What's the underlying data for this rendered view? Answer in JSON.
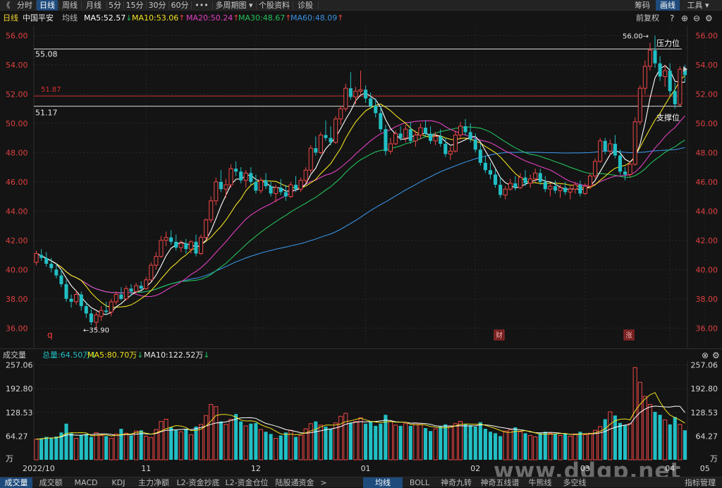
{
  "top_bar": {
    "back_glyph": "《",
    "tabs": [
      "分时",
      "日线",
      "周线",
      "月线",
      "5分",
      "15分",
      "30分",
      "60分",
      "•••",
      "多周期图 ▾",
      "个股资料",
      "诊股"
    ],
    "active_tab": 1,
    "right_items": [
      "筹码",
      "画线",
      "工具 ▾"
    ],
    "active_right": 1
  },
  "ma_bar": {
    "period": "日线",
    "stock_name": "中国平安",
    "label": "均线",
    "ma5": "MA5:52.57",
    "ma10": "MA10:53.06",
    "ma20": "MA20:50.24",
    "ma30": "MA30:48.67",
    "ma60": "MA60:48.09",
    "restore": "前复权"
  },
  "colors": {
    "up": "#f04646",
    "down": "#21bfc4",
    "ma5": "#ffffff",
    "ma10": "#f0e020",
    "ma20": "#e040c0",
    "ma30": "#22c05a",
    "ma60": "#3890e0"
  },
  "price_chart": {
    "y_ticks": [
      "56.00",
      "54.00",
      "52.00",
      "50.00",
      "48.00",
      "46.00",
      "44.00",
      "42.00",
      "40.00",
      "38.00",
      "36.00"
    ],
    "ylim": [
      35,
      56.6
    ],
    "lines": [
      {
        "label": "55.08",
        "value": 55.08,
        "color": "#d8d8d8"
      },
      {
        "label": "51.87",
        "value": 51.87,
        "color": "#d83030"
      },
      {
        "label": "51.17",
        "value": 51.17,
        "color": "#d8d8d8"
      }
    ],
    "annotations": {
      "high": "56.00→",
      "low": "←35.90",
      "pressure": "压力位",
      "support": "支撑位"
    },
    "markers": {
      "q": "q",
      "cai": "财",
      "zhang": "涨"
    }
  },
  "chart_data": {
    "type": "candlestick",
    "period": "日线",
    "x_axis_labels": [
      "2022/10",
      "11",
      "12",
      "01",
      "02",
      "03",
      "04",
      "05"
    ],
    "candles_ohlc": [
      [
        40.5,
        41.3,
        40.3,
        41.1
      ],
      [
        41.0,
        41.4,
        40.6,
        40.8
      ],
      [
        40.8,
        41.2,
        40.2,
        40.4
      ],
      [
        40.4,
        40.8,
        39.8,
        40.1
      ],
      [
        40.0,
        40.4,
        39.4,
        39.6
      ],
      [
        39.6,
        40.0,
        38.8,
        39.0
      ],
      [
        39.0,
        39.3,
        37.8,
        38.0
      ],
      [
        38.0,
        38.3,
        37.4,
        37.8
      ],
      [
        37.8,
        38.6,
        37.6,
        38.3
      ],
      [
        38.3,
        38.5,
        37.2,
        37.5
      ],
      [
        37.5,
        37.8,
        36.7,
        37.0
      ],
      [
        37.0,
        37.3,
        36.2,
        36.4
      ],
      [
        36.4,
        37.1,
        35.9,
        36.9
      ],
      [
        36.8,
        37.5,
        36.5,
        37.2
      ],
      [
        37.2,
        37.8,
        36.9,
        37.1
      ],
      [
        37.1,
        38.0,
        36.8,
        37.8
      ],
      [
        37.8,
        38.5,
        37.6,
        38.3
      ],
      [
        38.3,
        38.8,
        37.9,
        38.0
      ],
      [
        38.0,
        38.9,
        37.9,
        38.7
      ],
      [
        38.7,
        39.0,
        38.2,
        38.5
      ],
      [
        38.5,
        39.1,
        38.4,
        38.9
      ],
      [
        38.9,
        39.2,
        38.6,
        38.7
      ],
      [
        38.7,
        39.5,
        38.6,
        39.3
      ],
      [
        39.3,
        40.5,
        39.2,
        40.3
      ],
      [
        40.3,
        41.2,
        40.0,
        40.9
      ],
      [
        40.9,
        42.3,
        40.8,
        42.0
      ],
      [
        42.0,
        42.6,
        41.6,
        42.2
      ],
      [
        42.2,
        42.7,
        41.7,
        41.9
      ],
      [
        41.9,
        42.4,
        41.3,
        41.5
      ],
      [
        41.5,
        42.0,
        41.2,
        41.8
      ],
      [
        41.8,
        42.1,
        41.1,
        41.4
      ],
      [
        41.4,
        42.0,
        41.1,
        41.9
      ],
      [
        41.9,
        42.4,
        40.9,
        41.1
      ],
      [
        41.1,
        42.4,
        41.0,
        42.2
      ],
      [
        42.2,
        43.5,
        42.0,
        43.4
      ],
      [
        43.4,
        45.0,
        43.2,
        44.7
      ],
      [
        44.7,
        46.3,
        44.4,
        46.0
      ],
      [
        46.0,
        46.8,
        45.3,
        45.5
      ],
      [
        45.5,
        46.2,
        44.9,
        45.8
      ],
      [
        45.8,
        47.2,
        45.6,
        46.9
      ],
      [
        46.9,
        47.4,
        46.4,
        46.7
      ],
      [
        46.7,
        47.0,
        45.9,
        46.1
      ],
      [
        46.1,
        46.8,
        45.6,
        46.6
      ],
      [
        46.6,
        47.0,
        45.8,
        46.0
      ],
      [
        46.0,
        46.5,
        45.2,
        45.4
      ],
      [
        45.4,
        46.3,
        45.2,
        46.1
      ],
      [
        46.1,
        46.6,
        45.5,
        45.7
      ],
      [
        45.7,
        46.0,
        45.0,
        45.2
      ],
      [
        45.2,
        45.8,
        44.6,
        45.6
      ],
      [
        45.6,
        46.2,
        45.1,
        45.3
      ],
      [
        45.3,
        45.8,
        44.7,
        45.0
      ],
      [
        45.0,
        46.0,
        44.9,
        45.8
      ],
      [
        45.8,
        46.4,
        45.3,
        45.5
      ],
      [
        45.5,
        46.3,
        45.3,
        46.1
      ],
      [
        46.1,
        47.0,
        45.9,
        46.8
      ],
      [
        46.8,
        48.5,
        46.6,
        48.3
      ],
      [
        48.3,
        49.1,
        47.8,
        48.0
      ],
      [
        48.0,
        49.4,
        47.9,
        49.2
      ],
      [
        49.2,
        50.2,
        48.8,
        49.0
      ],
      [
        49.0,
        49.8,
        48.5,
        48.7
      ],
      [
        48.7,
        50.5,
        48.6,
        50.3
      ],
      [
        50.3,
        51.2,
        49.9,
        51.0
      ],
      [
        51.0,
        52.7,
        50.8,
        52.4
      ],
      [
        52.4,
        53.5,
        51.6,
        51.8
      ],
      [
        51.8,
        52.5,
        51.3,
        52.2
      ],
      [
        52.2,
        53.6,
        52.0,
        52.3
      ],
      [
        52.3,
        52.6,
        51.4,
        51.7
      ],
      [
        51.7,
        52.1,
        51.0,
        51.2
      ],
      [
        51.2,
        51.7,
        50.4,
        50.7
      ],
      [
        50.7,
        51.2,
        49.4,
        49.6
      ],
      [
        49.6,
        49.9,
        47.8,
        48.1
      ],
      [
        48.1,
        49.0,
        47.9,
        48.6
      ],
      [
        48.6,
        49.5,
        48.5,
        49.3
      ],
      [
        49.3,
        49.8,
        48.8,
        49.0
      ],
      [
        49.0,
        49.9,
        48.7,
        49.6
      ],
      [
        49.6,
        50.1,
        48.6,
        48.8
      ],
      [
        48.8,
        49.5,
        48.4,
        49.2
      ],
      [
        49.2,
        50.0,
        48.9,
        49.7
      ],
      [
        49.7,
        50.2,
        49.1,
        49.3
      ],
      [
        49.3,
        49.8,
        48.6,
        48.8
      ],
      [
        48.8,
        49.4,
        48.5,
        49.1
      ],
      [
        49.1,
        49.6,
        48.4,
        48.6
      ],
      [
        48.6,
        49.0,
        47.7,
        47.9
      ],
      [
        47.9,
        48.4,
        47.5,
        48.1
      ],
      [
        48.1,
        49.5,
        48.0,
        49.2
      ],
      [
        49.2,
        50.1,
        48.9,
        49.8
      ],
      [
        49.8,
        50.3,
        49.2,
        49.4
      ],
      [
        49.4,
        50.0,
        48.7,
        48.9
      ],
      [
        48.9,
        49.3,
        48.0,
        48.2
      ],
      [
        48.2,
        48.6,
        47.1,
        47.3
      ],
      [
        47.3,
        47.8,
        46.6,
        46.8
      ],
      [
        46.8,
        47.3,
        46.2,
        46.5
      ],
      [
        46.5,
        46.9,
        45.6,
        45.8
      ],
      [
        45.8,
        46.3,
        44.9,
        45.1
      ],
      [
        45.1,
        45.7,
        44.8,
        45.5
      ],
      [
        45.5,
        46.2,
        45.4,
        45.9
      ],
      [
        45.9,
        46.4,
        45.4,
        45.6
      ],
      [
        45.6,
        46.6,
        45.5,
        46.3
      ],
      [
        46.3,
        46.8,
        45.7,
        45.9
      ],
      [
        45.9,
        46.5,
        45.6,
        46.2
      ],
      [
        46.2,
        46.9,
        46.0,
        46.6
      ],
      [
        46.6,
        46.9,
        45.8,
        46.0
      ],
      [
        46.0,
        46.4,
        45.3,
        45.5
      ],
      [
        45.5,
        45.9,
        45.0,
        45.7
      ],
      [
        45.7,
        46.1,
        45.2,
        45.4
      ],
      [
        45.4,
        45.8,
        44.9,
        45.6
      ],
      [
        45.6,
        46.0,
        45.1,
        45.3
      ],
      [
        45.3,
        45.7,
        44.8,
        45.5
      ],
      [
        45.5,
        46.0,
        45.2,
        45.8
      ],
      [
        45.8,
        46.1,
        45.0,
        45.2
      ],
      [
        45.2,
        45.9,
        45.1,
        45.7
      ],
      [
        45.7,
        46.6,
        45.5,
        46.4
      ],
      [
        46.4,
        47.6,
        46.2,
        47.4
      ],
      [
        47.4,
        49.0,
        47.3,
        48.8
      ],
      [
        48.8,
        49.0,
        47.9,
        48.1
      ],
      [
        48.1,
        48.9,
        47.8,
        48.6
      ],
      [
        48.6,
        49.2,
        47.6,
        47.8
      ],
      [
        47.8,
        48.2,
        46.5,
        46.7
      ],
      [
        46.7,
        47.0,
        46.1,
        46.5
      ],
      [
        46.5,
        47.4,
        46.3,
        47.2
      ],
      [
        47.2,
        50.4,
        47.1,
        50.1
      ],
      [
        50.1,
        52.6,
        49.9,
        52.4
      ],
      [
        52.4,
        54.3,
        52.0,
        53.9
      ],
      [
        53.9,
        55.5,
        53.6,
        55.0
      ],
      [
        55.0,
        56.0,
        53.8,
        54.1
      ],
      [
        54.1,
        54.6,
        52.9,
        53.2
      ],
      [
        53.2,
        54.0,
        52.5,
        53.6
      ],
      [
        53.6,
        54.1,
        51.9,
        52.2
      ],
      [
        52.2,
        52.8,
        51.0,
        51.3
      ],
      [
        51.3,
        53.9,
        51.2,
        53.7
      ],
      [
        53.7,
        54.0,
        52.8,
        53.3
      ]
    ],
    "ma5_last": 52.57,
    "ma10_last": 53.06,
    "ma20_last": 50.24,
    "ma30_last": 48.67,
    "ma60_last": 48.09,
    "volume": {
      "ylim": [
        0,
        260
      ],
      "y_ticks": [
        "257.06",
        "192.80",
        "128.53",
        "64.27"
      ],
      "unit": "万",
      "values": [
        56,
        58,
        62,
        60,
        63,
        74,
        98,
        72,
        58,
        66,
        70,
        62,
        74,
        66,
        64,
        58,
        70,
        84,
        72,
        66,
        78,
        80,
        64,
        60,
        82,
        104,
        110,
        88,
        80,
        76,
        84,
        68,
        90,
        96,
        120,
        150,
        144,
        104,
        96,
        110,
        124,
        104,
        92,
        98,
        100,
        82,
        76,
        70,
        58,
        66,
        74,
        80,
        62,
        66,
        84,
        98,
        104,
        94,
        90,
        84,
        100,
        118,
        126,
        100,
        104,
        114,
        98,
        104,
        92,
        98,
        122,
        104,
        94,
        92,
        98,
        92,
        100,
        96,
        86,
        78,
        84,
        90,
        96,
        92,
        98,
        104,
        96,
        94,
        90,
        102,
        84,
        76,
        72,
        64,
        78,
        82,
        88,
        76,
        72,
        66,
        62,
        72,
        76,
        72,
        70,
        66,
        72,
        64,
        70,
        76,
        68,
        72,
        80,
        90,
        110,
        130,
        120,
        100,
        94,
        98,
        250,
        210,
        172,
        150,
        130,
        122,
        108,
        96,
        116,
        96,
        80
      ],
      "header": {
        "label": "成交量",
        "total": "总量:64.50万",
        "ma5": "MA5:80.70万",
        "ma10": "MA10:122.52万"
      }
    }
  },
  "bottom_bar": {
    "tabs": [
      "成交量",
      "成交额",
      "MACD",
      "KDJ",
      "主力净额",
      "L2-资金抄底",
      "L2-资金仓位",
      "陆股通资金",
      ">"
    ],
    "active_tab": 0,
    "right_tabs": [
      "均线",
      "BOLL",
      "神奇九转",
      "神奇五线谱",
      "牛熊线",
      "多空线"
    ],
    "active_right": 0,
    "manage": "指标管理"
  },
  "watermark": "www.ddgp.net"
}
